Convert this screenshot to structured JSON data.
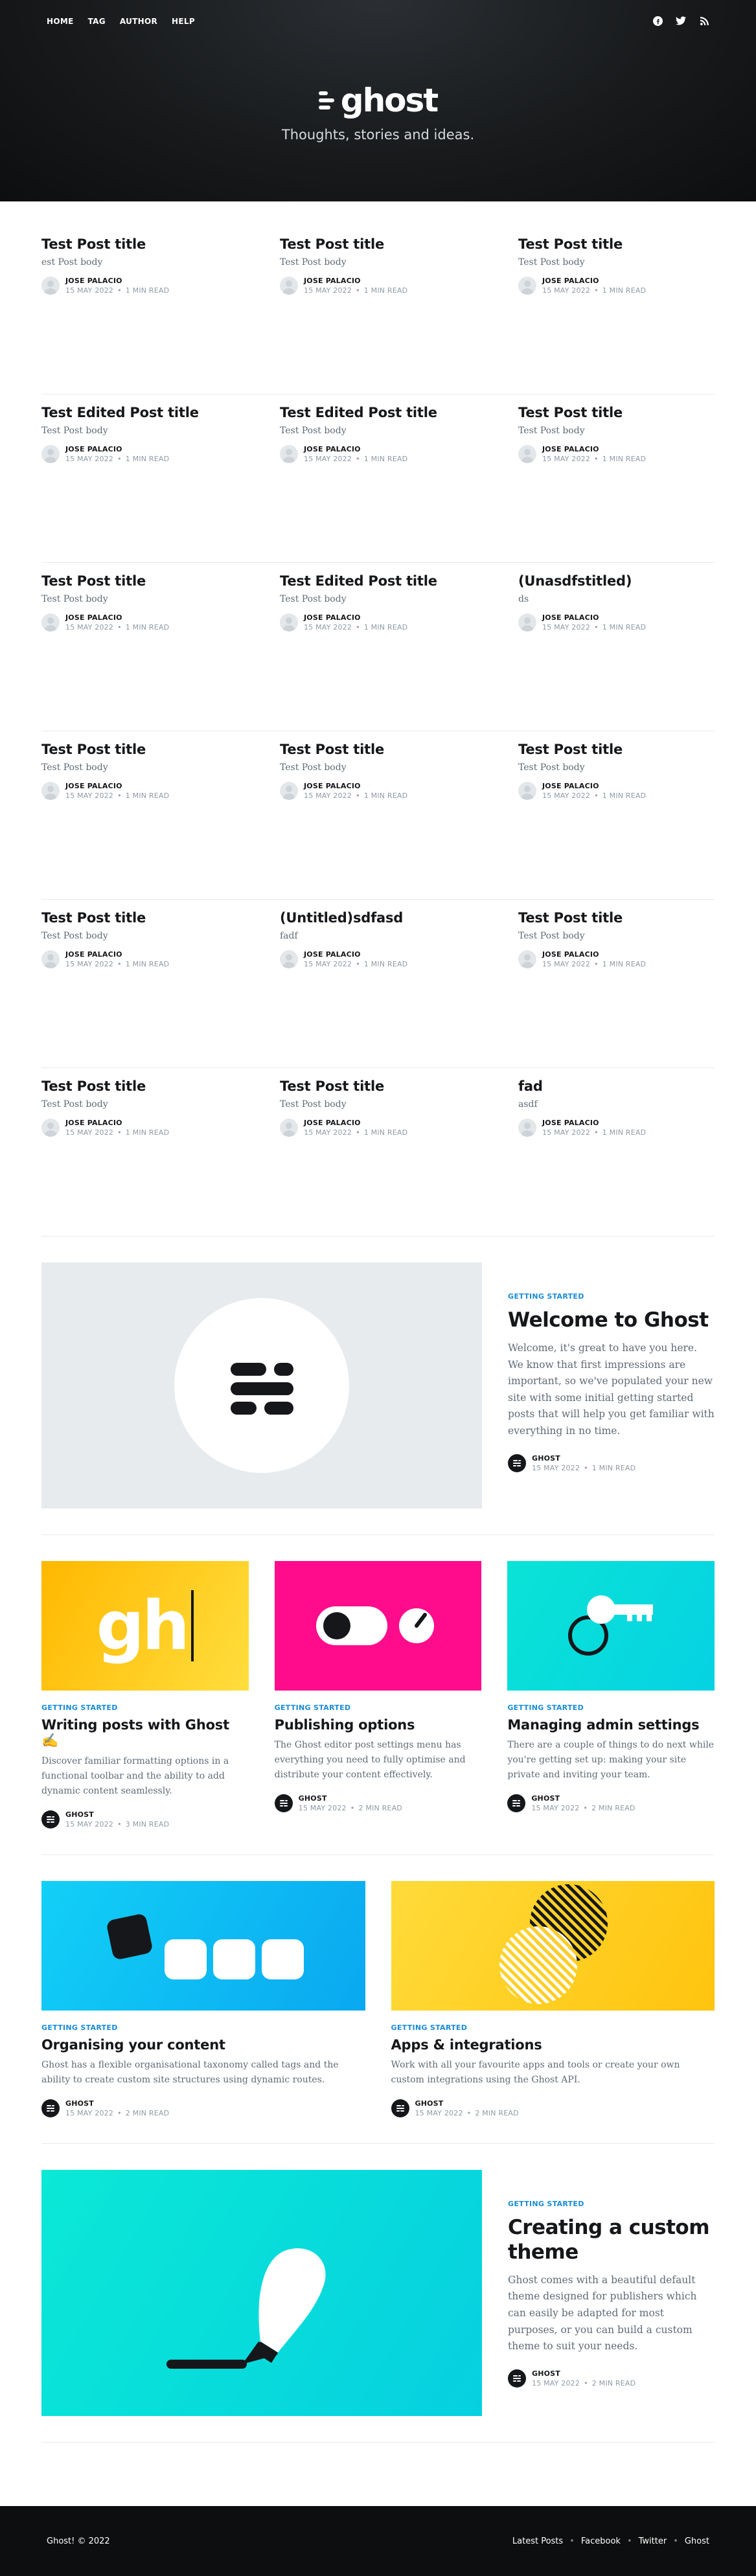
{
  "nav": {
    "items": [
      "HOME",
      "TAG",
      "AUTHOR",
      "HELP"
    ]
  },
  "social": [
    "facebook-icon",
    "twitter-icon",
    "rss-icon"
  ],
  "brand": {
    "logo_text": "ghost",
    "tagline": "Thoughts, stories and ideas."
  },
  "simple_posts": [
    {
      "title": "Test Post title",
      "excerpt": "est Post body",
      "author": "JOSE PALACIO",
      "date": "15 MAY 2022",
      "read": "1 MIN READ"
    },
    {
      "title": "Test Post title",
      "excerpt": "Test Post body",
      "author": "JOSE PALACIO",
      "date": "15 MAY 2022",
      "read": "1 MIN READ"
    },
    {
      "title": "Test Post title",
      "excerpt": "Test Post body",
      "author": "JOSE PALACIO",
      "date": "15 MAY 2022",
      "read": "1 MIN READ"
    },
    {
      "title": "Test Edited Post title",
      "excerpt": "Test Post body",
      "author": "JOSE PALACIO",
      "date": "15 MAY 2022",
      "read": "1 MIN READ"
    },
    {
      "title": "Test Edited Post title",
      "excerpt": "Test Post body",
      "author": "JOSE PALACIO",
      "date": "15 MAY 2022",
      "read": "1 MIN READ"
    },
    {
      "title": "Test Post title",
      "excerpt": "Test Post body",
      "author": "JOSE PALACIO",
      "date": "15 MAY 2022",
      "read": "1 MIN READ"
    },
    {
      "title": "Test Post title",
      "excerpt": "Test Post body",
      "author": "JOSE PALACIO",
      "date": "15 MAY 2022",
      "read": "1 MIN READ"
    },
    {
      "title": "Test Edited Post title",
      "excerpt": "Test Post body",
      "author": "JOSE PALACIO",
      "date": "15 MAY 2022",
      "read": "1 MIN READ"
    },
    {
      "title": "(Unasdfstitled)",
      "excerpt": "ds",
      "author": "JOSE PALACIO",
      "date": "15 MAY 2022",
      "read": "1 MIN READ"
    },
    {
      "title": "Test Post title",
      "excerpt": "Test Post body",
      "author": "JOSE PALACIO",
      "date": "15 MAY 2022",
      "read": "1 MIN READ"
    },
    {
      "title": "Test Post title",
      "excerpt": "Test Post body",
      "author": "JOSE PALACIO",
      "date": "15 MAY 2022",
      "read": "1 MIN READ"
    },
    {
      "title": "Test Post title",
      "excerpt": "Test Post body",
      "author": "JOSE PALACIO",
      "date": "15 MAY 2022",
      "read": "1 MIN READ"
    },
    {
      "title": "Test Post title",
      "excerpt": "Test Post body",
      "author": "JOSE PALACIO",
      "date": "15 MAY 2022",
      "read": "1 MIN READ"
    },
    {
      "title": "(Untitled)sdfasd",
      "excerpt": "fadf",
      "author": "JOSE PALACIO",
      "date": "15 MAY 2022",
      "read": "1 MIN READ"
    },
    {
      "title": "Test Post title",
      "excerpt": "Test Post body",
      "author": "JOSE PALACIO",
      "date": "15 MAY 2022",
      "read": "1 MIN READ"
    },
    {
      "title": "Test Post title",
      "excerpt": "Test Post body",
      "author": "JOSE PALACIO",
      "date": "15 MAY 2022",
      "read": "1 MIN READ"
    },
    {
      "title": "Test Post title",
      "excerpt": "Test Post body",
      "author": "JOSE PALACIO",
      "date": "15 MAY 2022",
      "read": "1 MIN READ"
    },
    {
      "title": "fad",
      "excerpt": "asdf",
      "author": "JOSE PALACIO",
      "date": "15 MAY 2022",
      "read": "1 MIN READ"
    }
  ],
  "featured": {
    "tag": "GETTING STARTED",
    "title": "Welcome to Ghost",
    "excerpt": "Welcome, it's great to have you here. We know that first impressions are important, so we've populated your new site with some initial getting started posts that will help you get familiar with everything in no time.",
    "author": "GHOST",
    "date": "15 MAY 2022",
    "read": "1 MIN READ",
    "image_bg": "#e7ebee"
  },
  "row_three": [
    {
      "tag": "GETTING STARTED",
      "title": "Writing posts with Ghost ✍️",
      "excerpt": "Discover familiar formatting options in a functional toolbar and the ability to add dynamic content seamlessly.",
      "author": "GHOST",
      "date": "15 MAY 2022",
      "read": "3 MIN READ",
      "image_bg": "#ffc522",
      "image_text": "gh"
    },
    {
      "tag": "GETTING STARTED",
      "title": "Publishing options",
      "excerpt": "The Ghost editor post settings menu has everything you need to fully optimise and distribute your content effectively.",
      "author": "GHOST",
      "date": "15 MAY 2022",
      "read": "2 MIN READ",
      "image_bg": "#ff0c8c"
    },
    {
      "tag": "GETTING STARTED",
      "title": "Managing admin settings",
      "excerpt": "There are a couple of things to do next while you're getting set up: making your site private and inviting your team.",
      "author": "GHOST",
      "date": "15 MAY 2022",
      "read": "2 MIN READ",
      "image_bg": "#08dfd6"
    }
  ],
  "row_two": [
    {
      "tag": "GETTING STARTED",
      "title": "Organising your content",
      "excerpt": "Ghost has a flexible organisational taxonomy called tags and the ability to create custom site structures using dynamic routes.",
      "author": "GHOST",
      "date": "15 MAY 2022",
      "read": "2 MIN READ",
      "image_bg": "#16c6f5"
    },
    {
      "tag": "GETTING STARTED",
      "title": "Apps & integrations",
      "excerpt": "Work with all your favourite apps and tools or create your own custom integrations using the Ghost API.",
      "author": "GHOST",
      "date": "15 MAY 2022",
      "read": "2 MIN READ",
      "image_bg": "#ffd22e"
    }
  ],
  "featured2": {
    "tag": "GETTING STARTED",
    "title": "Creating a custom theme",
    "excerpt": "Ghost comes with a beautiful default theme designed for publishers which can easily be adapted for most purposes, or you can build a custom theme to suit your needs.",
    "author": "GHOST",
    "date": "15 MAY 2022",
    "read": "2 MIN READ",
    "image_bg": "#0ae0d6"
  },
  "footer": {
    "copyright": "Ghost! © 2022",
    "links": [
      "Latest Posts",
      "Facebook",
      "Twitter",
      "Ghost"
    ]
  }
}
